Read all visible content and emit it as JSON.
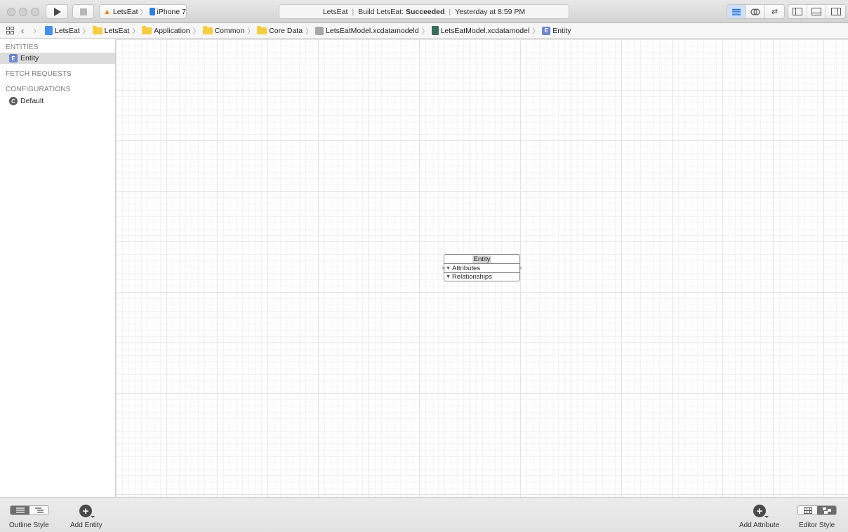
{
  "toolbar": {
    "scheme_project": "LetsEat",
    "scheme_device": "iPhone 7",
    "status_project": "LetsEat",
    "status_build_prefix": "Build LetsEat:",
    "status_build_result": "Succeeded",
    "status_time": "Yesterday at 8:59 PM"
  },
  "jumpbar": {
    "crumbs": [
      "LetsEat",
      "LetsEat",
      "Application",
      "Common",
      "Core Data",
      "LetsEatModel.xcdatamodeld",
      "LetsEatModel.xcdatamodel",
      "Entity"
    ]
  },
  "sidebar": {
    "entities_header": "ENTITIES",
    "entity_item": "Entity",
    "entity_badge": "E",
    "fetch_header": "FETCH REQUESTS",
    "configurations_header": "CONFIGURATIONS",
    "config_item": "Default",
    "config_badge": "C"
  },
  "canvas": {
    "entity_title": "Entity",
    "attributes_label": "Attributes",
    "relationships_label": "Relationships"
  },
  "bottombar": {
    "outline_style_label": "Outline Style",
    "add_entity_label": "Add Entity",
    "add_attribute_label": "Add Attribute",
    "editor_style_label": "Editor Style"
  },
  "colors": {
    "folder": "#f4cd45",
    "entity_badge": "#6e85c9",
    "selection": "#dcdcdc",
    "status_success": "#222222"
  }
}
